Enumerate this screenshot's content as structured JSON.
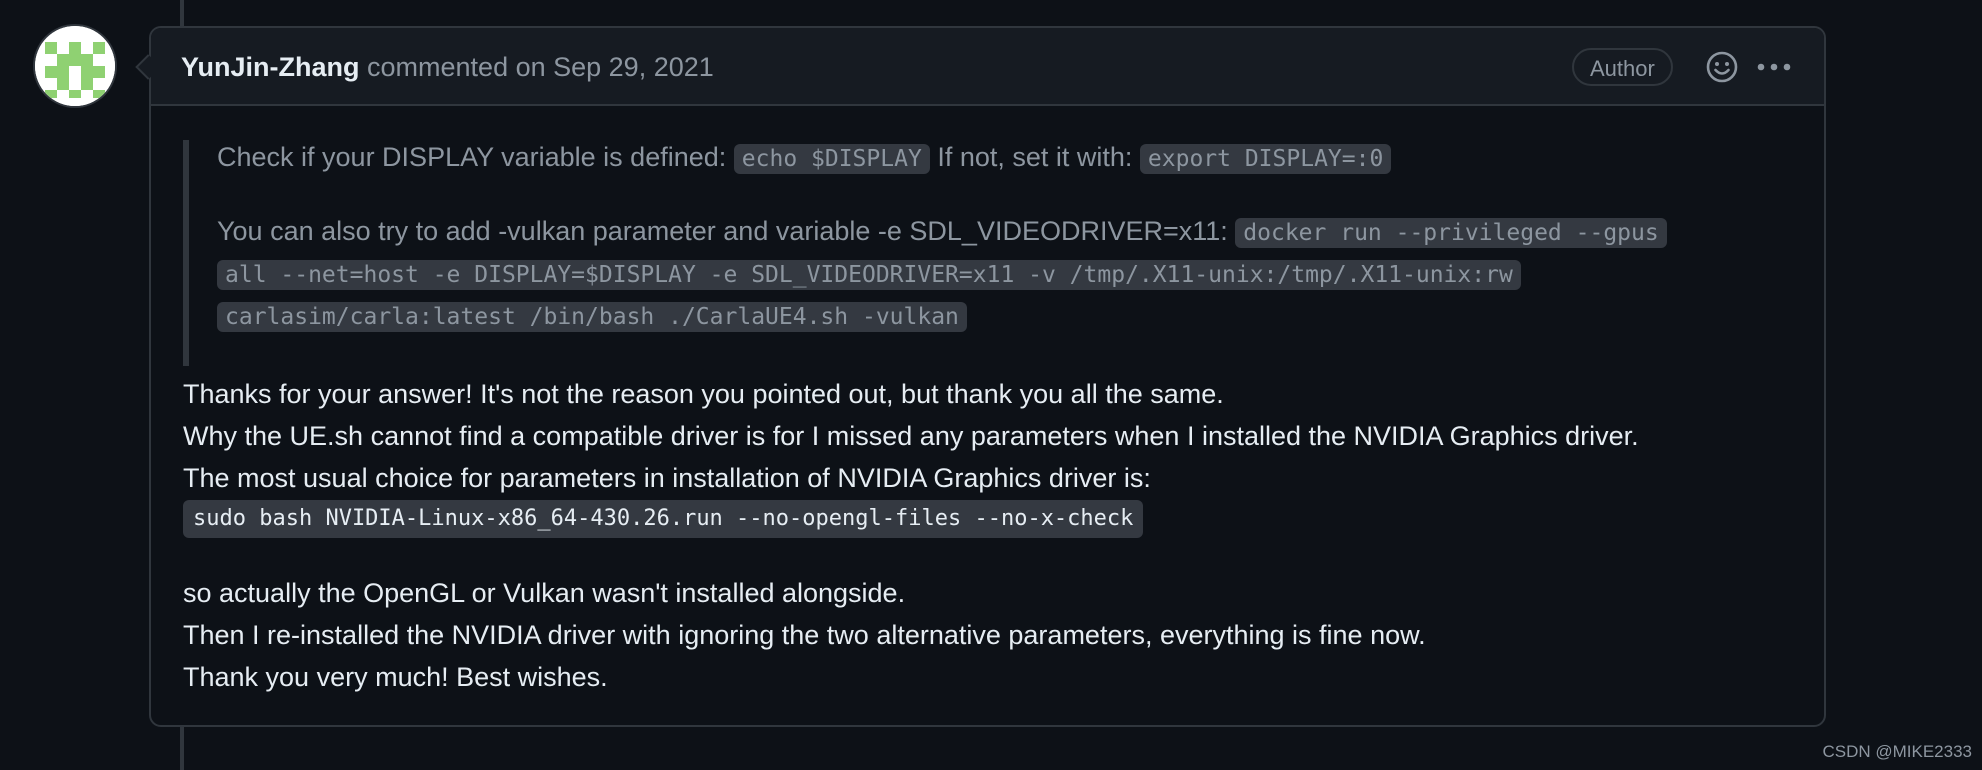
{
  "comment": {
    "author": "YunJin-Zhang",
    "commented_text": "commented on Sep 29, 2021",
    "badge": "Author",
    "quote": {
      "line1_text": "Check if your DISPLAY variable is defined:",
      "line1_code": "echo $DISPLAY",
      "line1_mid": "If not, set it with:",
      "line1_code2": "export DISPLAY=:0",
      "line2_text": "You can also try to add -vulkan parameter and variable -e SDL_VIDEODRIVER=x11:",
      "line2_code_a": "docker run --privileged --gpus",
      "line2_code_b": "all --net=host -e DISPLAY=$DISPLAY -e SDL_VIDEODRIVER=x11 -v /tmp/.X11-unix:/tmp/.X11-unix:rw",
      "line2_code_c": "carlasim/carla:latest /bin/bash ./CarlaUE4.sh -vulkan"
    },
    "body": {
      "p1": "Thanks for your answer! It's not the reason you pointed out, but thank you all the same.",
      "p2": "Why the UE.sh cannot find a compatible driver is for I missed any parameters when I installed the NVIDIA Graphics driver.",
      "p3": "The most usual choice for parameters in installation of NVIDIA Graphics driver is:",
      "code": "sudo bash NVIDIA-Linux-x86_64-430.26.run --no-opengl-files --no-x-check",
      "p4": "so actually the OpenGL or Vulkan wasn't installed alongside.",
      "p5": "Then I re-installed the NVIDIA driver with ignoring the two alternative parameters, everything is fine now.",
      "p6": "Thank you very much! Best wishes."
    }
  },
  "icons": {
    "avatar": "identicon-avatar",
    "reaction": "smiley-icon",
    "menu": "kebab-menu-icon"
  },
  "colors": {
    "background": "#0d1117",
    "header_bg": "#161b22",
    "border": "#30363d",
    "muted_text": "#8d96a0",
    "text": "#e6edf3",
    "code_bg": "#343941",
    "identicon_green": "#8fd172"
  },
  "watermark": "CSDN @MIKE2333"
}
